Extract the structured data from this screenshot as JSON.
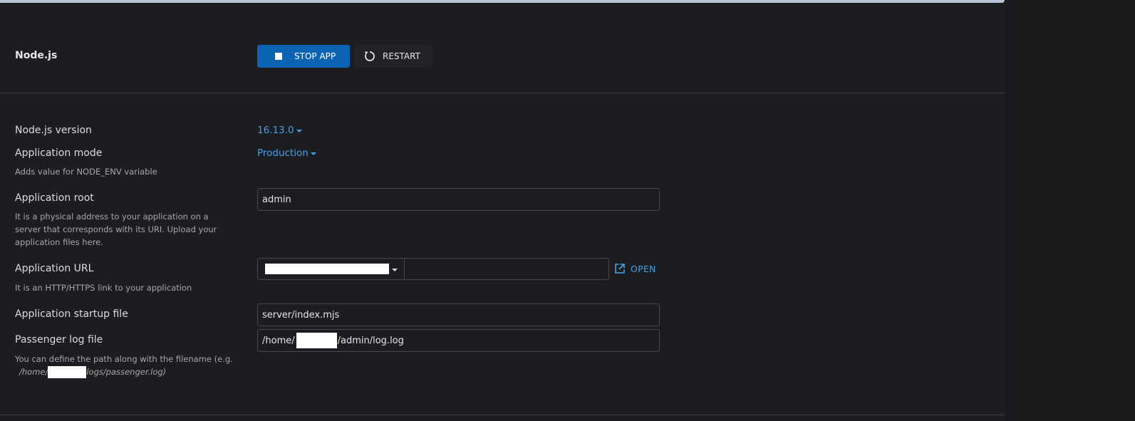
{
  "header": {
    "title": "Node.js",
    "stop_label": "STOP APP",
    "restart_label": "RESTART"
  },
  "form": {
    "version": {
      "label": "Node.js version",
      "value": "16.13.0"
    },
    "mode": {
      "label": "Application mode",
      "value": "Production",
      "hint": "Adds value for NODE_ENV variable"
    },
    "root": {
      "label": "Application root",
      "value": "admin",
      "hint": "It is a physical address to your application on a server that corresponds with its URI. Upload your application files here."
    },
    "url": {
      "label": "Application URL",
      "hint": "It is an HTTP/HTTPS link to your application",
      "open_label": "OPEN"
    },
    "startup": {
      "label": "Application startup file",
      "value": "server/index.mjs"
    },
    "log": {
      "label": "Passenger log file",
      "value_prefix": "/home/",
      "value_suffix": "/admin/log.log",
      "hint_prefix": "You can define the path along with the filename (e.g.",
      "hint_example_prefix": "/home/",
      "hint_example_suffix": "logs/passenger.log)"
    }
  },
  "colors": {
    "accent": "#0c63b4",
    "link": "#4a9fe8"
  }
}
